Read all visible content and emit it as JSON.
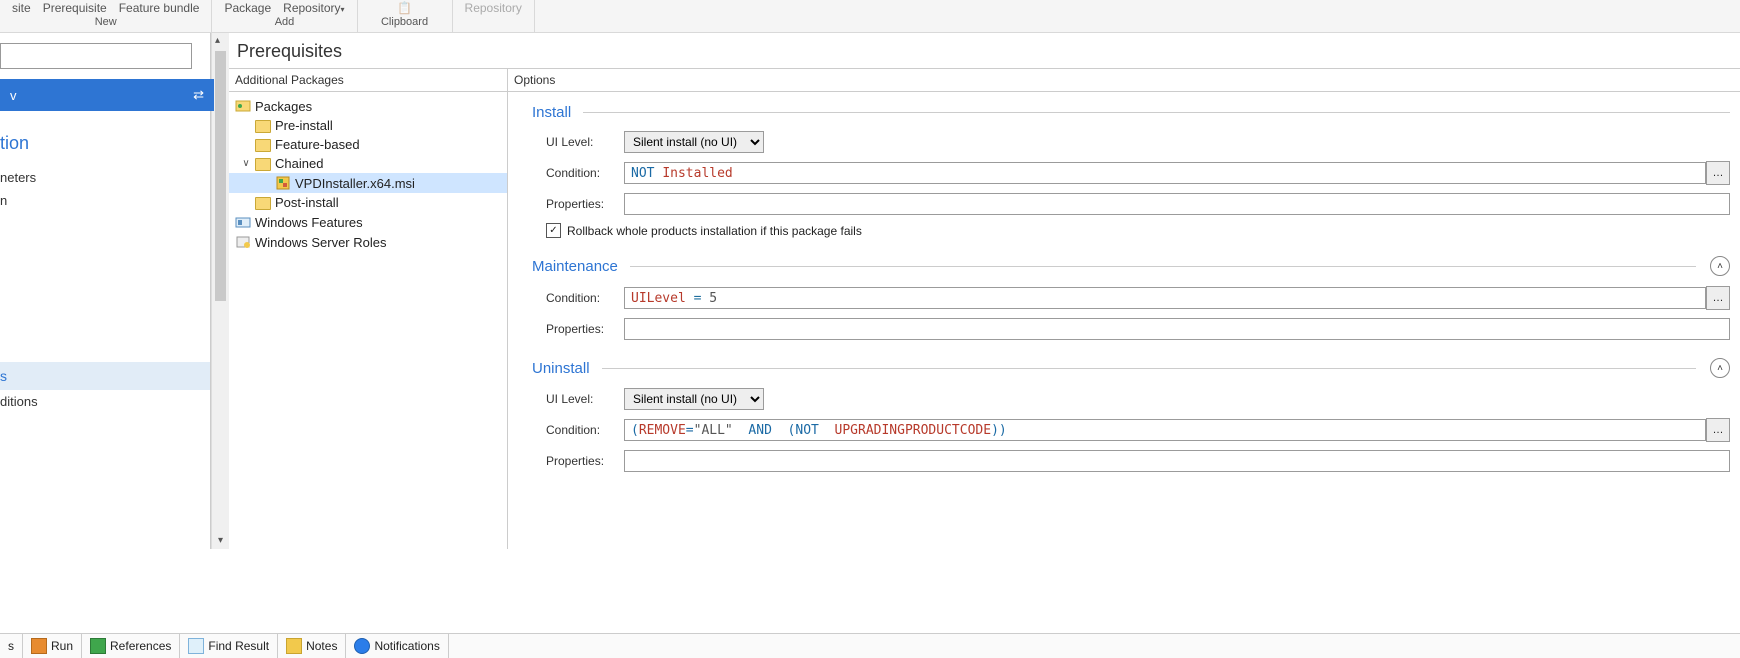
{
  "ribbon": {
    "group_new": {
      "label": "New",
      "items": [
        "site",
        "Prerequisite",
        "Feature bundle"
      ]
    },
    "group_add": {
      "label": "Add",
      "items": [
        "Package",
        "Repository"
      ]
    },
    "group_clip": {
      "label": "Clipboard",
      "items": [
        ""
      ]
    },
    "group_repo": {
      "label": "",
      "items": [
        "Repository"
      ]
    }
  },
  "left": {
    "button_label": "v",
    "heading": "tion",
    "items": [
      "neters",
      "n"
    ],
    "selected": "s",
    "last": "ditions",
    "swap_glyph": "⇄"
  },
  "title": "Prerequisites",
  "tree": {
    "header": "Additional Packages",
    "root": "Packages",
    "children": [
      "Pre-install",
      "Feature-based",
      "Chained"
    ],
    "chained_child": "VPDInstaller.x64.msi",
    "post": "Post-install",
    "wf": "Windows Features",
    "wsr": "Windows Server Roles"
  },
  "options": {
    "header": "Options",
    "install": {
      "title": "Install",
      "ui_label": "UI Level:",
      "ui_value": "Silent install (no UI)",
      "cond_label": "Condition:",
      "cond_kw1": "NOT ",
      "cond_kw2": "Installed",
      "prop_label": "Properties:",
      "rollback": "Rollback whole products installation if this package fails"
    },
    "maint": {
      "title": "Maintenance",
      "cond_label": "Condition:",
      "cond_kw1": "UILevel",
      "cond_op": " = ",
      "cond_num": "5",
      "prop_label": "Properties:"
    },
    "uninst": {
      "title": "Uninstall",
      "ui_label": "UI Level:",
      "ui_value": "Silent install (no UI)",
      "cond_label": "Condition:",
      "c1": "(",
      "c2": "REMOVE",
      "c3": "=",
      "c4": "\"ALL\"",
      "c5": "  AND  (NOT  ",
      "c6": "UPGRADINGPRODUCTCODE",
      "c7": "))",
      "prop_label": "Properties:"
    }
  },
  "status": {
    "s1": "s",
    "run": "Run",
    "ref": "References",
    "find": "Find Result",
    "notes": "Notes",
    "notif": "Notifications"
  }
}
